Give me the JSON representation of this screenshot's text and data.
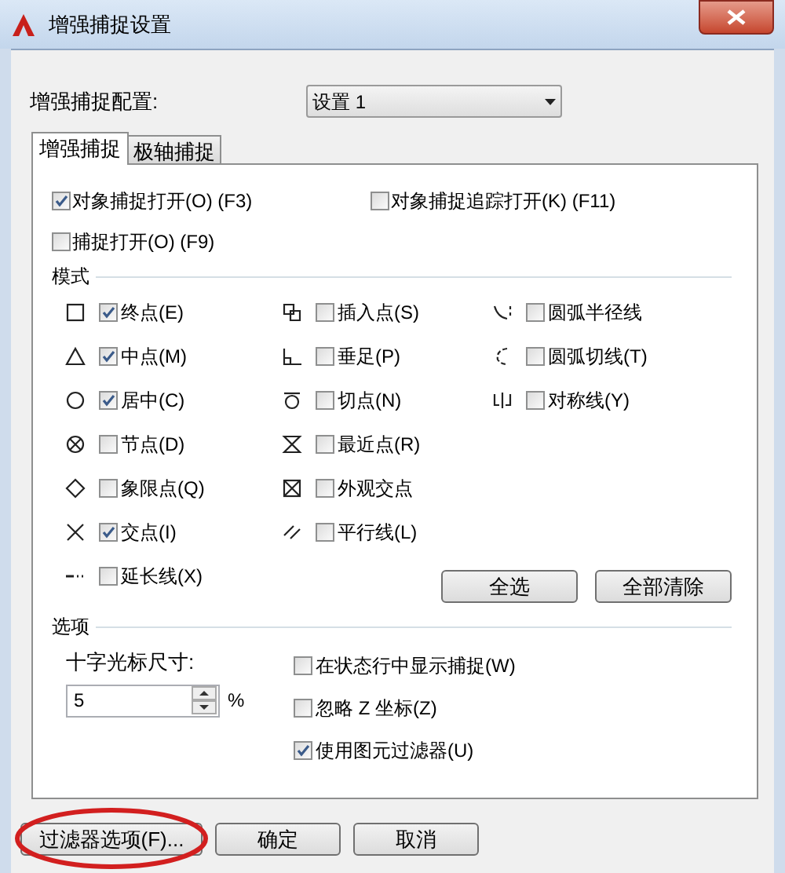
{
  "window": {
    "title": "增强捕捉设置"
  },
  "profile": {
    "label": "增强捕捉配置:",
    "value": "设置 1"
  },
  "tabs": [
    {
      "label": "增强捕捉",
      "selected": true
    },
    {
      "label": "极轴捕捉",
      "selected": false
    }
  ],
  "toggles": [
    {
      "label": "对象捕捉打开(O) (F3)",
      "checked": true
    },
    {
      "label": "对象捕捉追踪打开(K) (F11)",
      "checked": false
    },
    {
      "label": "捕捉打开(O) (F9)",
      "checked": false
    }
  ],
  "modes_title": "模式",
  "mode_columns": [
    [
      {
        "kind": "square",
        "label": "终点(E)",
        "checked": true
      },
      {
        "kind": "triangle",
        "label": "中点(M)",
        "checked": true
      },
      {
        "kind": "circle",
        "label": "居中(C)",
        "checked": true
      },
      {
        "kind": "node",
        "label": "节点(D)",
        "checked": false
      },
      {
        "kind": "diamond",
        "label": "象限点(Q)",
        "checked": false
      },
      {
        "kind": "cross",
        "label": "交点(I)",
        "checked": true
      },
      {
        "kind": "extension",
        "label": "延长线(X)",
        "checked": false
      }
    ],
    [
      {
        "kind": "insertion",
        "label": "插入点(S)",
        "checked": false
      },
      {
        "kind": "perpendicular",
        "label": "垂足(P)",
        "checked": false
      },
      {
        "kind": "tangent",
        "label": "切点(N)",
        "checked": false
      },
      {
        "kind": "nearest",
        "label": "最近点(R)",
        "checked": false
      },
      {
        "kind": "apparent",
        "label": "外观交点",
        "checked": false
      },
      {
        "kind": "parallel",
        "label": "平行线(L)",
        "checked": false
      }
    ],
    [
      {
        "kind": "arcradius",
        "label": "圆弧半径线",
        "checked": false
      },
      {
        "kind": "arctangent",
        "label": "圆弧切线(T)",
        "checked": false
      },
      {
        "kind": "symmetric",
        "label": "对称线(Y)",
        "checked": false
      }
    ]
  ],
  "mode_buttons": [
    "全选",
    "全部清除"
  ],
  "options_title": "选项",
  "crosshair": {
    "label": "十字光标尺寸:",
    "value": "5",
    "unit": "%"
  },
  "options": [
    {
      "label": "在状态行中显示捕捉(W)",
      "checked": false
    },
    {
      "label": "忽略 Z 坐标(Z)",
      "checked": false
    },
    {
      "label": "使用图元过滤器(U)",
      "checked": true
    }
  ],
  "footer_buttons": [
    "过滤器选项(F)...",
    "确定",
    "取消"
  ]
}
